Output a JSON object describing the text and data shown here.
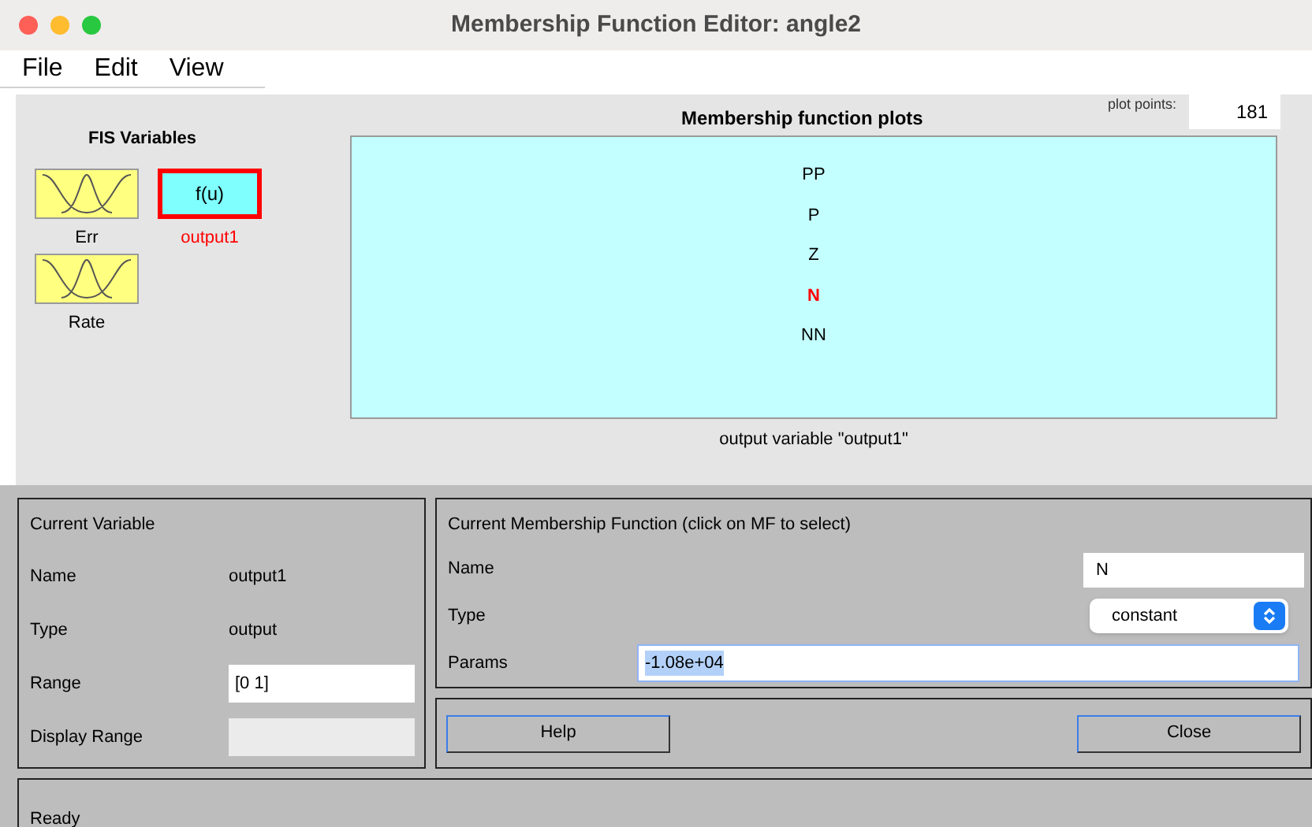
{
  "window": {
    "title": "Membership Function Editor: angle2"
  },
  "menu": [
    "File",
    "Edit",
    "View"
  ],
  "fis_variables": {
    "title": "FIS Variables",
    "items": [
      {
        "kind": "input",
        "label": "Err",
        "selected": false
      },
      {
        "kind": "output",
        "symbol": "f(u)",
        "label": "output1",
        "selected": true
      },
      {
        "kind": "input",
        "label": "Rate",
        "selected": false
      }
    ]
  },
  "plot": {
    "title": "Membership function plots",
    "plot_points_label": "plot points:",
    "plot_points": "181",
    "caption": "output variable \"output1\"",
    "functions": [
      {
        "label": "PP",
        "selected": false
      },
      {
        "label": "P",
        "selected": false
      },
      {
        "label": "Z",
        "selected": false
      },
      {
        "label": "N",
        "selected": true
      },
      {
        "label": "NN",
        "selected": false
      }
    ]
  },
  "current_variable": {
    "title": "Current Variable",
    "name_label": "Name",
    "name": "output1",
    "type_label": "Type",
    "type": "output",
    "range_label": "Range",
    "range": "[0 1]",
    "display_range_label": "Display Range"
  },
  "current_mf": {
    "title": "Current Membership Function (click on MF to select)",
    "name_label": "Name",
    "name": "N",
    "type_label": "Type",
    "type": "constant",
    "params_label": "Params",
    "params": "-1.08e+04"
  },
  "buttons": [
    "Help",
    "Close"
  ],
  "status_bar": "Ready"
}
